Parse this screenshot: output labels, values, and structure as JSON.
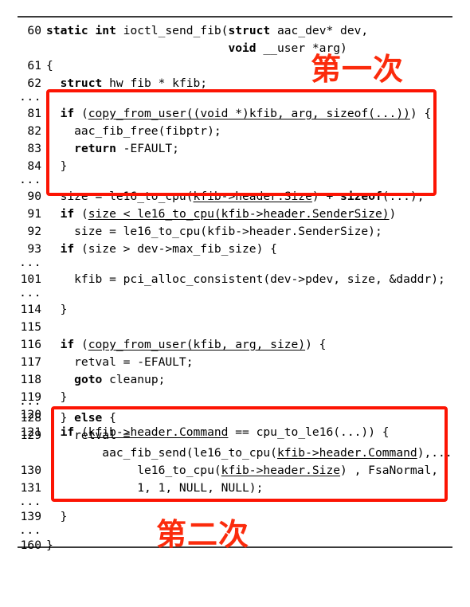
{
  "figure": {
    "kind": "source-code-listing",
    "language": "c",
    "function": "ioctl_send_fib",
    "accent_color": "#fc1403",
    "rule_color": "#3a3a3a",
    "text_color": "#000000",
    "background": "#ffffff"
  },
  "code": {
    "lines": [
      {
        "no": "60",
        "text": "static int ioctl_send_fib(struct aac_dev* dev,"
      },
      {
        "no": "",
        "text": "                          void __user *arg)"
      },
      {
        "no": "61",
        "text": "{"
      },
      {
        "no": "62",
        "text": "  struct hw_fib * kfib;"
      },
      {
        "no": "...",
        "text": ""
      },
      {
        "no": "81",
        "text": "  if (copy_from_user((void *)kfib, arg, sizeof(...))) {"
      },
      {
        "no": "82",
        "text": "    aac_fib_free(fibptr);"
      },
      {
        "no": "83",
        "text": "    return -EFAULT;"
      },
      {
        "no": "84",
        "text": "  }"
      },
      {
        "no": "...",
        "text": ""
      },
      {
        "no": "90",
        "text": "  size = le16_to_cpu(kfib->header.Size) + sizeof(...);"
      },
      {
        "no": "91",
        "text": "  if (size < le16_to_cpu(kfib->header.SenderSize))"
      },
      {
        "no": "92",
        "text": "    size = le16_to_cpu(kfib->header.SenderSize);"
      },
      {
        "no": "93",
        "text": "  if (size > dev->max_fib_size) {"
      },
      {
        "no": "...",
        "text": ""
      },
      {
        "no": "101",
        "text": "    kfib = pci_alloc_consistent(dev->pdev, size, &daddr);"
      },
      {
        "no": "...",
        "text": ""
      },
      {
        "no": "114",
        "text": "  }"
      },
      {
        "no": "115",
        "text": ""
      },
      {
        "no": "116",
        "text": "  if (copy_from_user(kfib, arg, size)) {"
      },
      {
        "no": "117",
        "text": "    retval = -EFAULT;"
      },
      {
        "no": "118",
        "text": "    goto cleanup;"
      },
      {
        "no": "119",
        "text": "  }"
      },
      {
        "no": "120",
        "text": ""
      },
      {
        "no": "121",
        "text": "  if (kfib->header.Command == cpu_to_le16(...)) {"
      },
      {
        "no": "...",
        "text": ""
      },
      {
        "no": "128",
        "text": "  } else {"
      },
      {
        "no": "129",
        "text": "    retval ="
      },
      {
        "no": "",
        "text": "        aac_fib_send(le16_to_cpu(kfib->header.Command),..."
      },
      {
        "no": "130",
        "text": "             le16_to_cpu(kfib->header.Size) , FsaNormal,"
      },
      {
        "no": "131",
        "text": "             1, 1, NULL, NULL);"
      },
      {
        "no": "...",
        "text": ""
      },
      {
        "no": "139",
        "text": "  }"
      },
      {
        "no": "...",
        "text": ""
      },
      {
        "no": "160",
        "text": "}"
      }
    ],
    "keywords": [
      "static",
      "int",
      "struct",
      "void",
      "return",
      "goto",
      "if",
      "else",
      "sizeof"
    ],
    "underlined_expressions": [
      "copy_from_user((void *)kfib, arg, sizeof(...))",
      "kfib->header.Size",
      "size < le16_to_cpu(kfib->header.SenderSize)",
      "copy_from_user(kfib, arg, size)",
      "kfib->header.Command"
    ]
  },
  "annotations": {
    "first": {
      "label": "第一次",
      "color": "#fb2b0c"
    },
    "second": {
      "label": "第二次",
      "color": "#fb2b0c"
    }
  },
  "highlight_boxes": [
    {
      "name": "first-read",
      "lines": "81-90",
      "color": "#fc1403"
    },
    {
      "name": "second-read",
      "lines": "128-139",
      "color": "#fc1403"
    }
  ]
}
